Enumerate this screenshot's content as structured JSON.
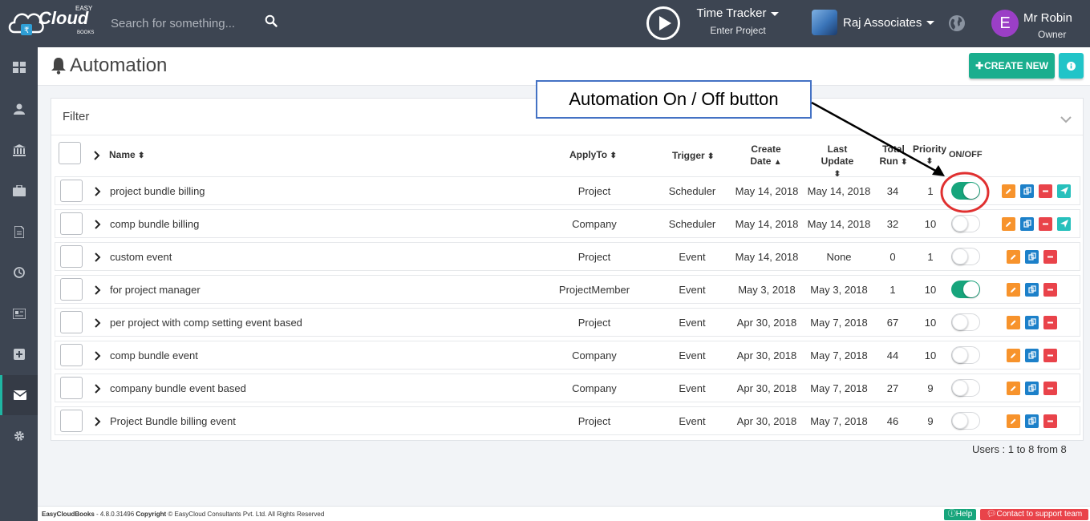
{
  "header": {
    "logo_easy": "EASY",
    "logo_cloud": "Cloud",
    "logo_books": "BOOKS",
    "search_placeholder": "Search for something...",
    "time_tracker_label": "Time Tracker",
    "time_tracker_sub": "Enter Project",
    "company_name": "Raj Associates",
    "user_initial": "E",
    "user_name": "Mr Robin",
    "user_role": "Owner"
  },
  "sidebar": {
    "items": [
      {
        "icon": "dashboard-icon"
      },
      {
        "icon": "user-icon"
      },
      {
        "icon": "bank-icon"
      },
      {
        "icon": "briefcase-icon"
      },
      {
        "icon": "document-icon"
      },
      {
        "icon": "clock-icon"
      },
      {
        "icon": "newspaper-icon"
      },
      {
        "icon": "plus-box-icon"
      },
      {
        "icon": "envelope-icon",
        "active": true
      },
      {
        "icon": "gear-icon"
      }
    ]
  },
  "page": {
    "title": "Automation",
    "create_label": "CREATE NEW",
    "filter_label": "Filter"
  },
  "table": {
    "headers": {
      "name": "Name",
      "apply_to": "ApplyTo",
      "trigger": "Trigger",
      "create_date_1": "Create",
      "create_date_2": "Date",
      "last_update_1": "Last",
      "last_update_2": "Update",
      "total_run_1": "Total",
      "total_run_2": "Run",
      "priority": "Priority",
      "on_off": "ON/OFF"
    },
    "rows": [
      {
        "name": "project bundle billing",
        "apply_to": "Project",
        "trigger": "Scheduler",
        "create_date": "May 14, 2018",
        "last_update": "May 14, 2018",
        "total_run": "34",
        "priority": "1",
        "on": true,
        "run_action": true
      },
      {
        "name": "comp bundle billing",
        "apply_to": "Company",
        "trigger": "Scheduler",
        "create_date": "May 14, 2018",
        "last_update": "May 14, 2018",
        "total_run": "32",
        "priority": "10",
        "on": false,
        "run_action": true
      },
      {
        "name": "custom event",
        "apply_to": "Project",
        "trigger": "Event",
        "create_date": "May 14, 2018",
        "last_update": "None",
        "total_run": "0",
        "priority": "1",
        "on": false,
        "run_action": false
      },
      {
        "name": "for project manager",
        "apply_to": "ProjectMember",
        "trigger": "Event",
        "create_date": "May 3, 2018",
        "last_update": "May 3, 2018",
        "total_run": "1",
        "priority": "10",
        "on": true,
        "run_action": false
      },
      {
        "name": "per project with comp setting event based",
        "apply_to": "Project",
        "trigger": "Event",
        "create_date": "Apr 30, 2018",
        "last_update": "May 7, 2018",
        "total_run": "67",
        "priority": "10",
        "on": false,
        "run_action": false
      },
      {
        "name": "comp bundle event",
        "apply_to": "Company",
        "trigger": "Event",
        "create_date": "Apr 30, 2018",
        "last_update": "May 7, 2018",
        "total_run": "44",
        "priority": "10",
        "on": false,
        "run_action": false
      },
      {
        "name": "company bundle event based",
        "apply_to": "Company",
        "trigger": "Event",
        "create_date": "Apr 30, 2018",
        "last_update": "May 7, 2018",
        "total_run": "27",
        "priority": "9",
        "on": false,
        "run_action": false
      },
      {
        "name": "Project Bundle billing event",
        "apply_to": "Project",
        "trigger": "Event",
        "create_date": "Apr 30, 2018",
        "last_update": "May 7, 2018",
        "total_run": "46",
        "priority": "9",
        "on": false,
        "run_action": false
      }
    ],
    "pager_text": "Users : 1 to 8 from 8"
  },
  "footer": {
    "app_name": "EasyCloudBooks",
    "version": " - 4.8.0.31496 ",
    "copyright_label": "Copyright",
    "copyright_text": " © EasyCloud Consultants Pvt. Ltd. All Rights Reserved",
    "help_label": "Help",
    "support_label": "Contact to support team"
  },
  "annotation": {
    "callout_text": "Automation On / Off button"
  },
  "colors": {
    "topbar": "#3d4552",
    "accent_green": "#1aae8e",
    "toggle_on": "#17a57c",
    "edit": "#f7932c",
    "copy": "#1c80c9",
    "delete": "#e9434a",
    "run": "#27c0bc",
    "annotation_border": "#4472c4",
    "annotation_circle": "#e03030"
  }
}
